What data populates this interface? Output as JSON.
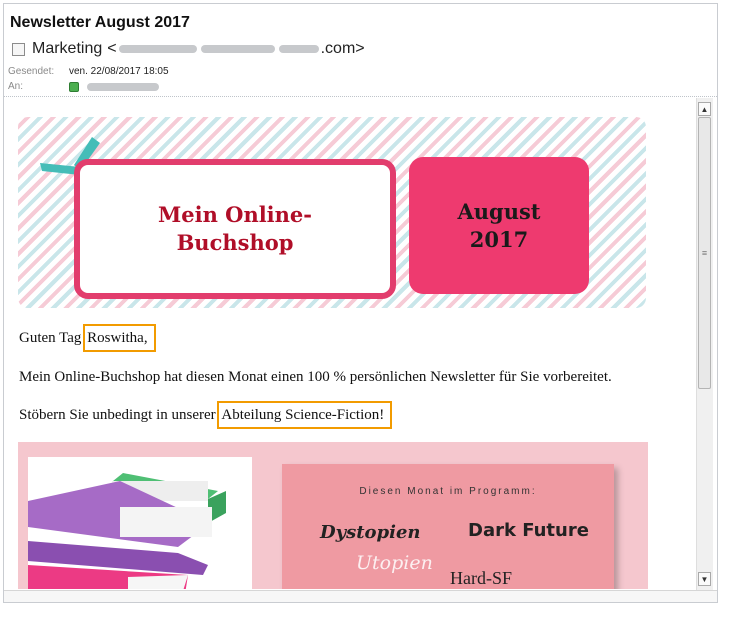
{
  "email": {
    "subject": "Newsletter August 2017",
    "from_name": "Marketing",
    "from_lt": "<",
    "from_domain": ".com>",
    "sent_label": "Gesendet:",
    "sent_value": "ven. 22/08/2017 18:05",
    "to_label": "An:"
  },
  "banner": {
    "title": "Mein Online-Buchshop",
    "month": "August 2017"
  },
  "body": {
    "greeting_prefix": "Guten Tag ",
    "greeting_name": "Roswitha,",
    "intro": "Mein Online-Buchshop hat diesen Monat einen 100 % persönlichen Newsletter für Sie vorbereitet.",
    "browse_prefix": "Stöbern Sie unbedingt in unserer ",
    "browse_link": "Abteilung Science-Fiction!"
  },
  "promo": {
    "heading": "Diesen Monat im Programm:",
    "genres": [
      "Dystopien",
      "Dark Future",
      "Utopien",
      "Hard-SF"
    ]
  },
  "colors": {
    "accent_pink": "#ee3a6f",
    "title_red": "#b00e28",
    "highlight_orange": "#f29b00",
    "promo_bg": "#f5c7ce"
  }
}
